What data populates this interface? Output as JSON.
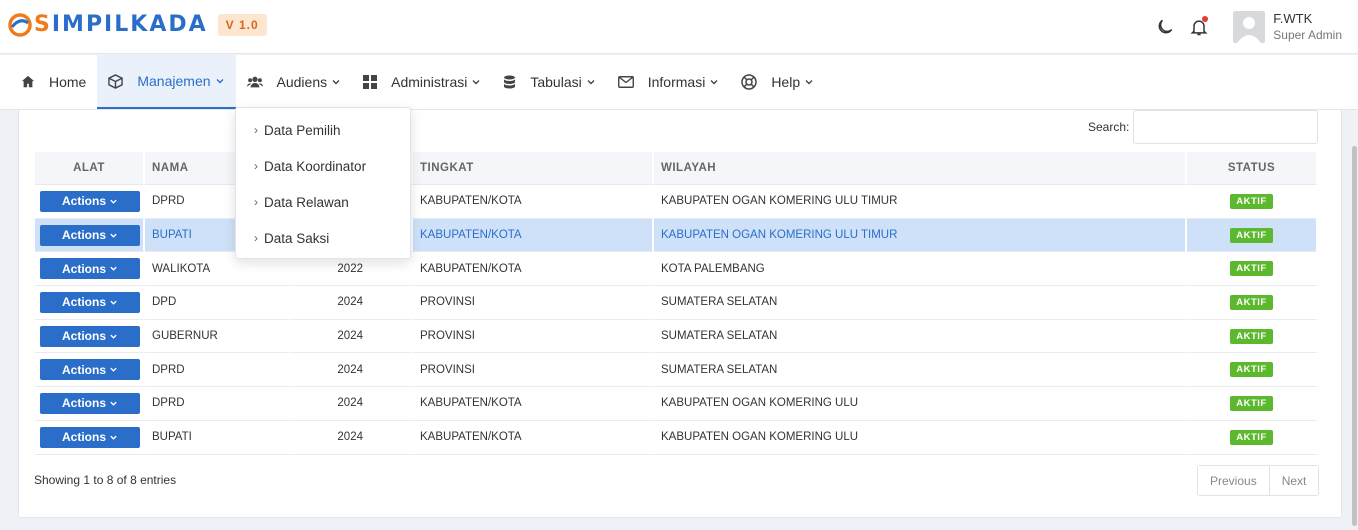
{
  "header": {
    "logo_prefix": "S",
    "logo_rest": "IMPILKADA",
    "version": "V 1.0",
    "user_name": "F.WTK",
    "user_role": "Super Admin"
  },
  "nav": {
    "items": [
      {
        "label": "Home",
        "icon": "home-icon"
      },
      {
        "label": "Manajemen",
        "icon": "cube-icon"
      },
      {
        "label": "Audiens",
        "icon": "users-icon"
      },
      {
        "label": "Administrasi",
        "icon": "grid-icon"
      },
      {
        "label": "Tabulasi",
        "icon": "database-icon"
      },
      {
        "label": "Informasi",
        "icon": "envelope-icon"
      },
      {
        "label": "Help",
        "icon": "lifebuoy-icon"
      }
    ],
    "active": "Manajemen"
  },
  "dropdown": {
    "items": [
      "Data Pemilih",
      "Data Koordinator",
      "Data Relawan",
      "Data Saksi"
    ]
  },
  "search": {
    "label": "Search:",
    "value": ""
  },
  "table": {
    "headers": {
      "alat": "ALAT",
      "nama": "NAMA",
      "tahun": "",
      "tingkat": "TINGKAT",
      "wilayah": "WILAYAH",
      "status": "STATUS"
    },
    "action_label": "Actions",
    "rows": [
      {
        "nama": "DPRD",
        "tahun": "",
        "tingkat": "KABUPATEN/KOTA",
        "wilayah": "KABUPATEN OGAN KOMERING ULU TIMUR",
        "status": "AKTIF"
      },
      {
        "nama": "BUPATI",
        "tahun": "",
        "tingkat": "KABUPATEN/KOTA",
        "wilayah": "KABUPATEN OGAN KOMERING ULU TIMUR",
        "status": "AKTIF"
      },
      {
        "nama": "WALIKOTA",
        "tahun": "2022",
        "tingkat": "KABUPATEN/KOTA",
        "wilayah": "KOTA PALEMBANG",
        "status": "AKTIF"
      },
      {
        "nama": "DPD",
        "tahun": "2024",
        "tingkat": "PROVINSI",
        "wilayah": "SUMATERA SELATAN",
        "status": "AKTIF"
      },
      {
        "nama": "GUBERNUR",
        "tahun": "2024",
        "tingkat": "PROVINSI",
        "wilayah": "SUMATERA SELATAN",
        "status": "AKTIF"
      },
      {
        "nama": "DPRD",
        "tahun": "2024",
        "tingkat": "PROVINSI",
        "wilayah": "SUMATERA SELATAN",
        "status": "AKTIF"
      },
      {
        "nama": "DPRD",
        "tahun": "2024",
        "tingkat": "KABUPATEN/KOTA",
        "wilayah": "KABUPATEN OGAN KOMERING ULU",
        "status": "AKTIF"
      },
      {
        "nama": "BUPATI",
        "tahun": "2024",
        "tingkat": "KABUPATEN/KOTA",
        "wilayah": "KABUPATEN OGAN KOMERING ULU",
        "status": "AKTIF"
      }
    ],
    "selected_row": 1
  },
  "footer": {
    "showing": "Showing 1 to 8 of 8 entries",
    "prev": "Previous",
    "next": "Next"
  },
  "colors": {
    "primary": "#2a6ec9",
    "accent": "#f07b1c",
    "success": "#5cb82d",
    "selected_row": "#cfe1f8"
  }
}
